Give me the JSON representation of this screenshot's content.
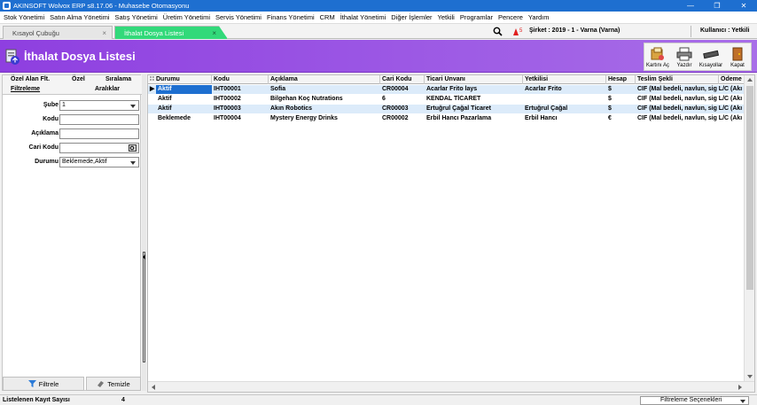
{
  "window": {
    "title": "AKINSOFT Wolvox ERP s8.17.06 - Muhasebe Otomasyonu",
    "minimize": "—",
    "maximize": "❐",
    "close": "✕"
  },
  "menu": [
    "Stok Yönetimi",
    "Satın Alma Yönetimi",
    "Satış Yönetimi",
    "Üretim Yönetimi",
    "Servis Yönetimi",
    "Finans Yönetimi",
    "CRM",
    "İthalat Yönetimi",
    "Diğer İşlemler",
    "Yetkili",
    "Programlar",
    "Pencere",
    "Yardım"
  ],
  "tabs": [
    {
      "label": "Kısayol Çubuğu",
      "close": "×"
    },
    {
      "label": "İthalat Dosya Listesi",
      "close": "×"
    }
  ],
  "topbar": {
    "alarm_count": "5",
    "company": "Şirket : 2019 - 1 - Varna (Varna)",
    "user": "Kullanıcı : Yetkili"
  },
  "header": {
    "title": "İthalat Dosya Listesi"
  },
  "toolbar": [
    "Kartını Aç",
    "Yazdır",
    "Kısayollar",
    "Kapat"
  ],
  "left_tabs": {
    "ozel_alan": "Özel Alan Flt.",
    "ozel": "Özel",
    "siralama": "Sıralama",
    "filtreleme": "Filtreleme",
    "araliklar": "Aralıklar"
  },
  "filters": {
    "sube_label": "Şube",
    "sube_value": "1",
    "kodu_label": "Kodu",
    "kodu_value": "",
    "aciklama_label": "Açıklama",
    "aciklama_value": "",
    "cari_label": "Cari Kodu",
    "cari_value": "",
    "durum_label": "Durumu",
    "durum_value": "Beklemede,Aktif"
  },
  "buttons": {
    "filtrele": "Filtrele",
    "temizle": "Temizle"
  },
  "columns": [
    "Durumu",
    "Kodu",
    "Açıklama",
    "Cari Kodu",
    "Ticari Unvanı",
    "Yetkilisi",
    "Hesap",
    "Teslim Şekli",
    "Ödeme"
  ],
  "rows": [
    [
      "Aktif",
      "IHT00001",
      "Sofia",
      "CR00004",
      "Acarlar Frito lays",
      "Acarlar Frito",
      "$",
      "CIF (Mal bedeli, navlun, sig L/C (Akı"
    ],
    [
      "Aktif",
      "IHT00002",
      "Bilgehan Koç Nutrations",
      "6",
      "KENDAL TİCARET",
      "",
      "$",
      "CIF (Mal bedeli, navlun, sig L/C (Akı"
    ],
    [
      "Aktif",
      "IHT00003",
      "Akın Robotics",
      "CR00003",
      "Ertuğrul Çağal Ticaret",
      "Ertuğrul Çağal",
      "$",
      "CIF (Mal bedeli, navlun, sig L/C (Akı"
    ],
    [
      "Beklemede",
      "IHT00004",
      "Mystery Energy Drinks",
      "CR00002",
      "Erbil Hancı Pazarlama",
      "Erbil Hancı",
      "€",
      "CIF (Mal bedeli, navlun, sig L/C (Akı"
    ]
  ],
  "status": {
    "label": "Listelenen Kayıt Sayısı",
    "count": "4",
    "filter_options": "Filtreleme Seçenekleri"
  },
  "colors": {
    "titlebar": "#1e6fd0",
    "header": "#8e3fe0",
    "active_tab": "#32d97a",
    "selected_row": "#dcebfa"
  },
  "icons": {
    "search": "search-icon",
    "alarm": "alarm-icon",
    "header": "import-file-icon"
  }
}
